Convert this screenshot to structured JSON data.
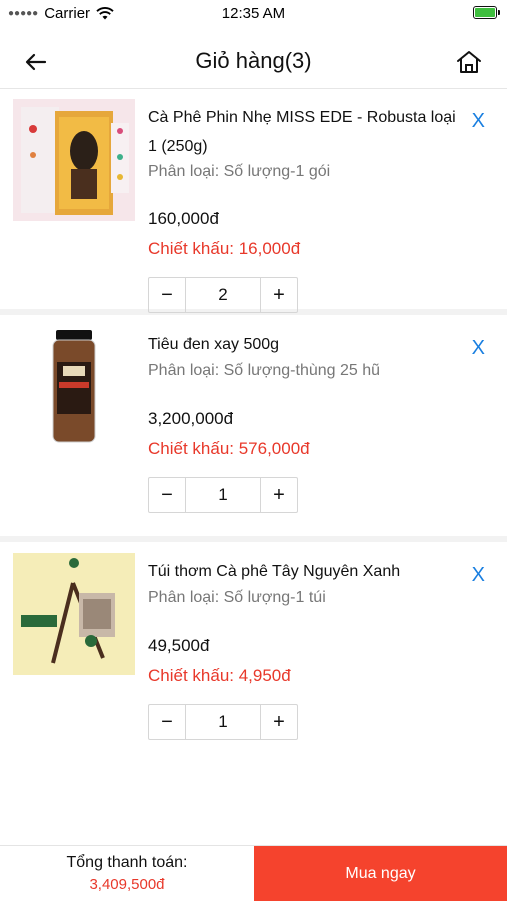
{
  "status_bar": {
    "carrier": "Carrier",
    "time": "12:35 AM"
  },
  "navbar": {
    "title": "Giỏ hàng(3)"
  },
  "cart": {
    "items": [
      {
        "name": "Cà Phê Phin Nhẹ MISS EDE - Robusta loại 1 (250g)",
        "variant": "Phân loại: Số lượng-1 gói",
        "price": "160,000đ",
        "discount": "Chiết khấu: 16,000đ",
        "quantity": "2",
        "remove": "X",
        "minus": "−",
        "plus": "+"
      },
      {
        "name": "Tiêu đen xay 500g",
        "variant": "Phân loại: Số lượng-thùng 25 hũ",
        "price": "3,200,000đ",
        "discount": "Chiết khấu: 576,000đ",
        "quantity": "1",
        "remove": "X",
        "minus": "−",
        "plus": "+"
      },
      {
        "name": "Túi thơm Cà phê Tây Nguyên Xanh",
        "variant": "Phân loại: Số lượng-1 túi",
        "price": "49,500đ",
        "discount": "Chiết khấu: 4,950đ",
        "quantity": "1",
        "remove": "X",
        "minus": "−",
        "plus": "+"
      }
    ]
  },
  "footer": {
    "total_label": "Tổng thanh toán:",
    "total_value": "3,409,500đ",
    "buy_label": "Mua ngay"
  },
  "colors": {
    "accent": "#f5432d",
    "discount": "#e8382a",
    "remove": "#1a7fe0"
  },
  "icons": [
    "back-arrow-icon",
    "home-icon",
    "wifi-icon",
    "battery-icon"
  ]
}
